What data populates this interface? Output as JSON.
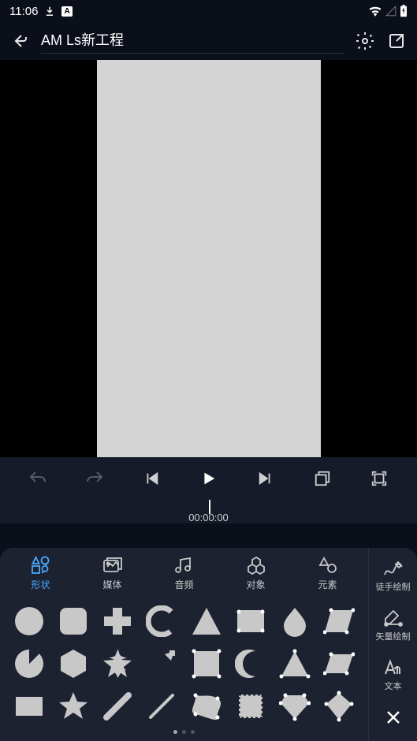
{
  "status": {
    "time": "11:06"
  },
  "header": {
    "title": "AM Ls新工程"
  },
  "timeline": {
    "timecode": "00:00:00"
  },
  "tabs": [
    {
      "label": "形状",
      "icon": "shapes",
      "active": true
    },
    {
      "label": "媒体",
      "icon": "media"
    },
    {
      "label": "音频",
      "icon": "audio"
    },
    {
      "label": "对象",
      "icon": "object"
    },
    {
      "label": "元素",
      "icon": "element"
    }
  ],
  "side": [
    {
      "label": "徒手绘制",
      "icon": "freehand"
    },
    {
      "label": "矢量绘制",
      "icon": "vector"
    },
    {
      "label": "文本",
      "icon": "text"
    }
  ],
  "shapes": [
    "circle",
    "rounded-square",
    "plus",
    "arc",
    "triangle",
    "rounded-rect",
    "drop",
    "trapezoid",
    "pie",
    "hexagon",
    "star5",
    "arrow",
    "square",
    "crescent",
    "triangle-pts",
    "parallelogram",
    "rectangle",
    "star5-outline",
    "line-thick",
    "line-thin",
    "blob",
    "stamp",
    "diamond",
    "kite"
  ]
}
